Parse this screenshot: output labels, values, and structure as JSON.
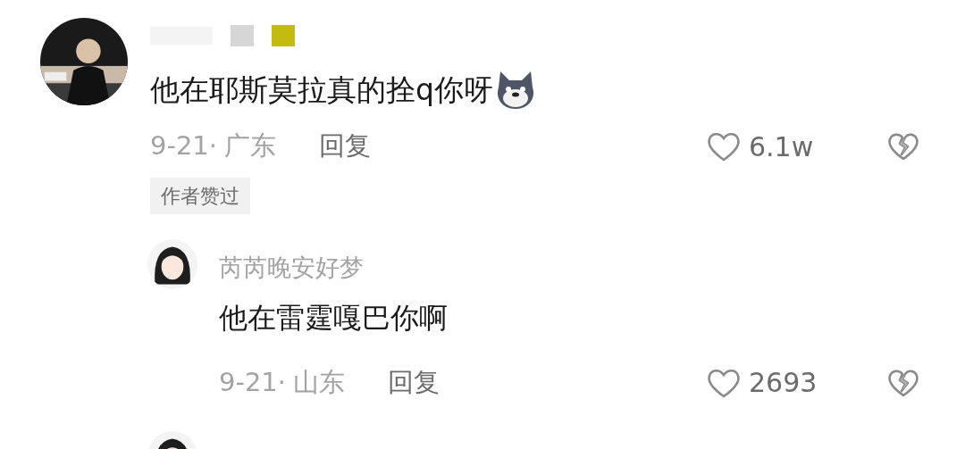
{
  "comments": [
    {
      "kind": "top",
      "text": "他在耶斯莫拉真的拴q你呀",
      "date": "9-21·",
      "region": "广东",
      "reply_label": "回复",
      "likes": "6.1w",
      "badge": "作者赞过"
    },
    {
      "kind": "reply",
      "username": "芮芮晚安好梦",
      "text": "他在雷霆嘎巴你啊",
      "date": "9-21·",
      "region": "山东",
      "reply_label": "回复",
      "likes": "2693"
    }
  ]
}
